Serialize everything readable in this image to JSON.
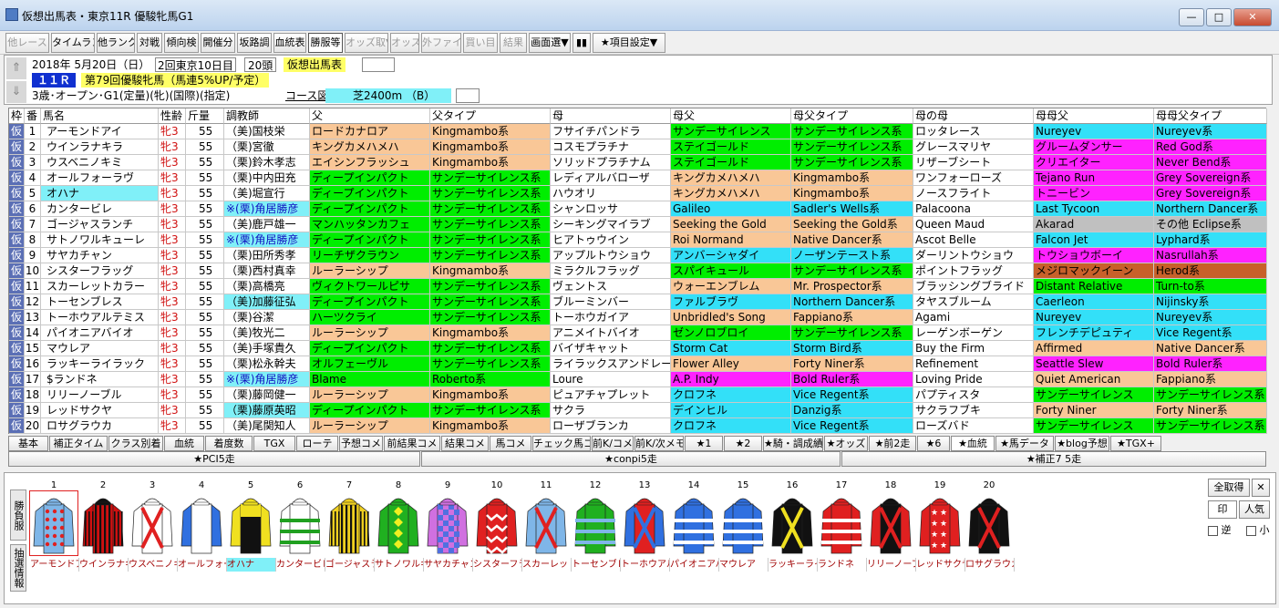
{
  "window": {
    "title": "仮想出馬表・東京11R 優駿牝馬G1",
    "min_label": "—",
    "max_label": "□",
    "close_label": "✕"
  },
  "toolbar": {
    "items": [
      {
        "label": "他レース",
        "disabled": true
      },
      {
        "label": "タイムランク"
      },
      {
        "label": "他ランク"
      },
      {
        "label": "対戦"
      },
      {
        "label": "傾向検"
      },
      {
        "label": "開催分"
      },
      {
        "label": "坂路調"
      },
      {
        "label": "血統表"
      },
      {
        "label": "勝服等",
        "active": true
      },
      {
        "label": "オッズ取▼",
        "disabled": true
      },
      {
        "label": "オッズ",
        "disabled": true
      },
      {
        "label": "外ファイル",
        "disabled": true
      },
      {
        "label": "買い目",
        "disabled": true
      },
      {
        "label": "結果",
        "disabled": true
      },
      {
        "label": "画面選▼"
      },
      {
        "label": "▮▮"
      },
      {
        "label": "★項目設定▼"
      }
    ]
  },
  "race": {
    "date": "2018年 5月20日（日）",
    "kai": "2回東京10日目",
    "heads": "20頭",
    "mode": "仮想出馬表",
    "race_no": "１１Ｒ",
    "name": "第79回優駿牝馬（馬連5%UP/予定）",
    "cond": "3歳･オープン･G1(定量)(牝)(国際)(指定)",
    "course_label": "コース図",
    "course": "芝2400m （B）",
    "up_arrow": "⇑",
    "down_arrow": "⇓"
  },
  "columns": [
    "枠",
    "番",
    "馬名",
    "性齢",
    "斤量",
    "調教師",
    "父",
    "父タイプ",
    "母",
    "母父",
    "母父タイプ",
    "母の母",
    "母母父",
    "母母父タイプ"
  ],
  "entries": [
    {
      "waku": "仮",
      "no": "1",
      "name": "アーモンドアイ",
      "sex": "牝3",
      "wt": "55",
      "trainer": "（美)国枝栄",
      "sire": "ロードカナロア",
      "stype": "Kingmambo系",
      "dam": "フサイチパンドラ",
      "damsire": "サンデーサイレンス",
      "dstype": "サンデーサイレンス系",
      "granddam": "ロッタレース",
      "ggsire": "Nureyev",
      "ggtype": "Nureyev系",
      "c_sire": "#f9c797",
      "c_stype": "#f9c797",
      "c_damsire": "#00ee00",
      "c_dstype": "#00ee00",
      "c_ggsire": "#33e0f8",
      "c_ggtype": "#33e0f8"
    },
    {
      "waku": "仮",
      "no": "2",
      "name": "ウインラナキラ",
      "sex": "牝3",
      "wt": "55",
      "trainer": "（栗)宮徹",
      "sire": "キングカメハメハ",
      "stype": "Kingmambo系",
      "dam": "コスモプラチナ",
      "damsire": "ステイゴールド",
      "dstype": "サンデーサイレンス系",
      "granddam": "グレースマリヤ",
      "ggsire": "グルームダンサー",
      "ggtype": "Red God系",
      "c_sire": "#f9c797",
      "c_stype": "#f9c797",
      "c_damsire": "#00ee00",
      "c_dstype": "#00ee00",
      "c_ggsire": "#ff22ff",
      "c_ggtype": "#ff22ff"
    },
    {
      "waku": "仮",
      "no": "3",
      "name": "ウスベニノキミ",
      "sex": "牝3",
      "wt": "55",
      "trainer": "（栗)鈴木孝志",
      "sire": "エイシンフラッシュ",
      "stype": "Kingmambo系",
      "dam": "ソリッドプラチナム",
      "damsire": "ステイゴールド",
      "dstype": "サンデーサイレンス系",
      "granddam": "リザーブシート",
      "ggsire": "クリエイター",
      "ggtype": "Never Bend系",
      "c_sire": "#f9c797",
      "c_stype": "#f9c797",
      "c_damsire": "#00ee00",
      "c_dstype": "#00ee00",
      "c_ggsire": "#ff22ff",
      "c_ggtype": "#ff22ff"
    },
    {
      "waku": "仮",
      "no": "4",
      "name": "オールフォーラヴ",
      "sex": "牝3",
      "wt": "55",
      "trainer": "（栗)中内田充",
      "sire": "ディープインパクト",
      "stype": "サンデーサイレンス系",
      "dam": "レディアルバローザ",
      "damsire": "キングカメハメハ",
      "dstype": "Kingmambo系",
      "granddam": "ワンフォーローズ",
      "ggsire": "Tejano Run",
      "ggtype": "Grey Sovereign系",
      "c_sire": "#00ee00",
      "c_stype": "#00ee00",
      "c_damsire": "#f9c797",
      "c_dstype": "#f9c797",
      "c_ggsire": "#ff22ff",
      "c_ggtype": "#ff22ff"
    },
    {
      "waku": "仮",
      "no": "5",
      "name": "オハナ",
      "sex": "牝3",
      "wt": "55",
      "trainer": "（美)堀宣行",
      "sire": "ディープインパクト",
      "stype": "サンデーサイレンス系",
      "dam": "ハウオリ",
      "damsire": "キングカメハメハ",
      "dstype": "Kingmambo系",
      "granddam": "ノースフライト",
      "ggsire": "トニービン",
      "ggtype": "Grey Sovereign系",
      "c_sire": "#00ee00",
      "c_stype": "#00ee00",
      "c_damsire": "#f9c797",
      "c_dstype": "#f9c797",
      "c_ggsire": "#ff22ff",
      "c_ggtype": "#ff22ff",
      "hl": true
    },
    {
      "waku": "仮",
      "no": "6",
      "name": "カンタービレ",
      "sex": "牝3",
      "wt": "55",
      "trainer": "※(栗)角居勝彦",
      "sire": "ディープインパクト",
      "stype": "サンデーサイレンス系",
      "dam": "シャンロッサ",
      "damsire": "Galileo",
      "dstype": "Sadler's Wells系",
      "granddam": "Palacoona",
      "ggsire": "Last Tycoon",
      "ggtype": "Northern Dancer系",
      "c_sire": "#00ee00",
      "c_stype": "#00ee00",
      "c_damsire": "#33e0f8",
      "c_dstype": "#33e0f8",
      "c_ggsire": "#33e0f8",
      "c_ggtype": "#33e0f8"
    },
    {
      "waku": "仮",
      "no": "7",
      "name": "ゴージャスランチ",
      "sex": "牝3",
      "wt": "55",
      "trainer": "（美)鹿戸雄一",
      "sire": "マンハッタンカフェ",
      "stype": "サンデーサイレンス系",
      "dam": "シーキングマイラブ",
      "damsire": "Seeking the Gold",
      "dstype": "Seeking the Gold系",
      "granddam": "Queen Maud",
      "ggsire": "Akarad",
      "ggtype": "その他 Eclipse系",
      "c_sire": "#00ee00",
      "c_stype": "#00ee00",
      "c_damsire": "#f9c797",
      "c_dstype": "#f9c797",
      "c_ggsire": "#c0c0c0",
      "c_ggtype": "#c0c0c0"
    },
    {
      "waku": "仮",
      "no": "8",
      "name": "サトノワルキューレ",
      "sex": "牝3",
      "wt": "55",
      "trainer": "※(栗)角居勝彦",
      "sire": "ディープインパクト",
      "stype": "サンデーサイレンス系",
      "dam": "ヒアトゥウイン",
      "damsire": "Roi Normand",
      "dstype": "Native Dancer系",
      "granddam": "Ascot Belle",
      "ggsire": "Falcon Jet",
      "ggtype": "Lyphard系",
      "c_sire": "#00ee00",
      "c_stype": "#00ee00",
      "c_damsire": "#f9c797",
      "c_dstype": "#f9c797",
      "c_ggsire": "#33e0f8",
      "c_ggtype": "#33e0f8"
    },
    {
      "waku": "仮",
      "no": "9",
      "name": "サヤカチャン",
      "sex": "牝3",
      "wt": "55",
      "trainer": "（栗)田所秀孝",
      "sire": "リーチザクラウン",
      "stype": "サンデーサイレンス系",
      "dam": "アップルトウショウ",
      "damsire": "アンバーシャダイ",
      "dstype": "ノーザンテースト系",
      "granddam": "ダーリントウショウ",
      "ggsire": "トウショウボーイ",
      "ggtype": "Nasrullah系",
      "c_sire": "#00ee00",
      "c_stype": "#00ee00",
      "c_damsire": "#33e0f8",
      "c_dstype": "#33e0f8",
      "c_ggsire": "#ff22ff",
      "c_ggtype": "#ff22ff"
    },
    {
      "waku": "仮",
      "no": "10",
      "name": "シスターフラッグ",
      "sex": "牝3",
      "wt": "55",
      "trainer": "（栗)西村真幸",
      "sire": "ルーラーシップ",
      "stype": "Kingmambo系",
      "dam": "ミラクルフラッグ",
      "damsire": "スパイキュール",
      "dstype": "サンデーサイレンス系",
      "granddam": "ポイントフラッグ",
      "ggsire": "メジロマックイーン",
      "ggtype": "Herod系",
      "c_sire": "#f9c797",
      "c_stype": "#f9c797",
      "c_damsire": "#00ee00",
      "c_dstype": "#00ee00",
      "c_ggsire": "#c8602a",
      "c_ggtype": "#c8602a"
    },
    {
      "waku": "仮",
      "no": "11",
      "name": "スカーレットカラー",
      "sex": "牝3",
      "wt": "55",
      "trainer": "（栗)高橋亮",
      "sire": "ヴィクトワールピサ",
      "stype": "サンデーサイレンス系",
      "dam": "ヴェントス",
      "damsire": "ウォーエンブレム",
      "dstype": "Mr. Prospector系",
      "granddam": "ブラッシングブライド",
      "ggsire": "Distant Relative",
      "ggtype": "Turn-to系",
      "c_sire": "#00ee00",
      "c_stype": "#00ee00",
      "c_damsire": "#f9c797",
      "c_dstype": "#f9c797",
      "c_ggsire": "#00ee00",
      "c_ggtype": "#00ee00"
    },
    {
      "waku": "仮",
      "no": "12",
      "name": "トーセンブレス",
      "sex": "牝3",
      "wt": "55",
      "trainer": "（美)加藤征弘",
      "sire": "ディープインパクト",
      "stype": "サンデーサイレンス系",
      "dam": "ブルーミンバー",
      "damsire": "ファルブラヴ",
      "dstype": "Northern Dancer系",
      "granddam": "タヤスブルーム",
      "ggsire": "Caerleon",
      "ggtype": "Nijinsky系",
      "c_sire": "#00ee00",
      "c_stype": "#00ee00",
      "c_damsire": "#33e0f8",
      "c_dstype": "#33e0f8",
      "c_ggsire": "#33e0f8",
      "c_ggtype": "#33e0f8"
    },
    {
      "waku": "仮",
      "no": "13",
      "name": "トーホウアルテミス",
      "sex": "牝3",
      "wt": "55",
      "trainer": "（栗)谷潔",
      "sire": "ハーツクライ",
      "stype": "サンデーサイレンス系",
      "dam": "トーホウガイア",
      "damsire": "Unbridled's Song",
      "dstype": "Fappiano系",
      "granddam": "Agami",
      "ggsire": "Nureyev",
      "ggtype": "Nureyev系",
      "c_sire": "#00ee00",
      "c_stype": "#00ee00",
      "c_damsire": "#f9c797",
      "c_dstype": "#f9c797",
      "c_ggsire": "#33e0f8",
      "c_ggtype": "#33e0f8"
    },
    {
      "waku": "仮",
      "no": "14",
      "name": "パイオニアバイオ",
      "sex": "牝3",
      "wt": "55",
      "trainer": "（美)牧光二",
      "sire": "ルーラーシップ",
      "stype": "Kingmambo系",
      "dam": "アニメイトバイオ",
      "damsire": "ゼンノロブロイ",
      "dstype": "サンデーサイレンス系",
      "granddam": "レーゲンボーゲン",
      "ggsire": "フレンチデピュティ",
      "ggtype": "Vice Regent系",
      "c_sire": "#f9c797",
      "c_stype": "#f9c797",
      "c_damsire": "#00ee00",
      "c_dstype": "#00ee00",
      "c_ggsire": "#33e0f8",
      "c_ggtype": "#33e0f8"
    },
    {
      "waku": "仮",
      "no": "15",
      "name": "マウレア",
      "sex": "牝3",
      "wt": "55",
      "trainer": "（美)手塚貴久",
      "sire": "ディープインパクト",
      "stype": "サンデーサイレンス系",
      "dam": "バイザキャット",
      "damsire": "Storm Cat",
      "dstype": "Storm Bird系",
      "granddam": "Buy the Firm",
      "ggsire": "Affirmed",
      "ggtype": "Native Dancer系",
      "c_sire": "#00ee00",
      "c_stype": "#00ee00",
      "c_damsire": "#33e0f8",
      "c_dstype": "#33e0f8",
      "c_ggsire": "#f9c797",
      "c_ggtype": "#f9c797"
    },
    {
      "waku": "仮",
      "no": "16",
      "name": "ラッキーライラック",
      "sex": "牝3",
      "wt": "55",
      "trainer": "（栗)松永幹夫",
      "sire": "オルフェーヴル",
      "stype": "サンデーサイレンス系",
      "dam": "ライラックスアンドレース",
      "damsire": "Flower Alley",
      "dstype": "Forty Niner系",
      "granddam": "Refinement",
      "ggsire": "Seattle Slew",
      "ggtype": "Bold Ruler系",
      "c_sire": "#00ee00",
      "c_stype": "#00ee00",
      "c_damsire": "#f9c797",
      "c_dstype": "#f9c797",
      "c_ggsire": "#ff22ff",
      "c_ggtype": "#ff22ff"
    },
    {
      "waku": "仮",
      "no": "17",
      "name": "$ランドネ",
      "sex": "牝3",
      "wt": "55",
      "trainer": "※(栗)角居勝彦",
      "sire": "Blame",
      "stype": "Roberto系",
      "dam": "Loure",
      "damsire": "A.P. Indy",
      "dstype": "Bold Ruler系",
      "granddam": "Loving Pride",
      "ggsire": "Quiet American",
      "ggtype": "Fappiano系",
      "c_sire": "#00ee00",
      "c_stype": "#00ee00",
      "c_damsire": "#ff22ff",
      "c_dstype": "#ff22ff",
      "c_ggsire": "#f9c797",
      "c_ggtype": "#f9c797"
    },
    {
      "waku": "仮",
      "no": "18",
      "name": "リリーノーブル",
      "sex": "牝3",
      "wt": "55",
      "trainer": "（栗)藤岡健一",
      "sire": "ルーラーシップ",
      "stype": "Kingmambo系",
      "dam": "ピュアチャプレット",
      "damsire": "クロフネ",
      "dstype": "Vice Regent系",
      "granddam": "パプティスタ",
      "ggsire": "サンデーサイレンス",
      "ggtype": "サンデーサイレンス系",
      "c_sire": "#f9c797",
      "c_stype": "#f9c797",
      "c_damsire": "#33e0f8",
      "c_dstype": "#33e0f8",
      "c_ggsire": "#00ee00",
      "c_ggtype": "#00ee00"
    },
    {
      "waku": "仮",
      "no": "19",
      "name": "レッドサクヤ",
      "sex": "牝3",
      "wt": "55",
      "trainer": "（栗)藤原英昭",
      "sire": "ディープインパクト",
      "stype": "サンデーサイレンス系",
      "dam": "サクラ",
      "damsire": "デインヒル",
      "dstype": "Danzig系",
      "granddam": "サクラフブキ",
      "ggsire": "Forty Niner",
      "ggtype": "Forty Niner系",
      "c_sire": "#00ee00",
      "c_stype": "#00ee00",
      "c_damsire": "#33e0f8",
      "c_dstype": "#33e0f8",
      "c_ggsire": "#f9c797",
      "c_ggtype": "#f9c797"
    },
    {
      "waku": "仮",
      "no": "20",
      "name": "ロサグラウカ",
      "sex": "牝3",
      "wt": "55",
      "trainer": "（美)尾関知人",
      "sire": "ルーラーシップ",
      "stype": "Kingmambo系",
      "dam": "ローザブランカ",
      "damsire": "クロフネ",
      "dstype": "Vice Regent系",
      "granddam": "ローズバド",
      "ggsire": "サンデーサイレンス",
      "ggtype": "サンデーサイレンス系",
      "c_sire": "#f9c797",
      "c_stype": "#f9c797",
      "c_damsire": "#33e0f8",
      "c_dstype": "#33e0f8",
      "c_ggsire": "#00ee00",
      "c_ggtype": "#00ee00"
    }
  ],
  "tabs_row1": [
    "基本",
    "補正タイム",
    "クラス別着",
    "血統",
    "着度数",
    "TGX",
    "ローテ",
    "予想コメ",
    "前結果コメ",
    "結果コメ",
    "馬コメ",
    "チェック馬コメ",
    "前K/コメ",
    "前K/次メモ",
    "★1",
    "★2",
    "★騎・調成績",
    "★オッズ",
    "★前2走",
    "★6",
    "★血統",
    "★馬データ",
    "★blog予想",
    "★TGX+"
  ],
  "tabs_row2": [
    "★PCI5走",
    "★conpi5走",
    "★補正7 5走"
  ],
  "bottom": {
    "label_top": "勝負服",
    "label_bottom": "抽選情報",
    "buttons": {
      "all": "全取得",
      "close": "✕",
      "print": "印",
      "popular": "人気",
      "rev": "逆",
      "small": "小"
    },
    "silks": [
      {
        "no": "1",
        "body": "#7fb6e8",
        "sleeve": "#7fb6e8",
        "pat": "dots",
        "pc": "#e02020",
        "cap": "#7fb6e8",
        "name": "アーモンドアイ"
      },
      {
        "no": "2",
        "body": "#d01010",
        "sleeve": "#d01010",
        "pat": "vstripes",
        "pc": "#111111",
        "cap": "#111111",
        "name": "ウインラナキラ"
      },
      {
        "no": "3",
        "body": "#ffffff",
        "sleeve": "#ffffff",
        "pat": "cross",
        "pc": "#e02020",
        "cap": "#ffffff",
        "name": "ウスベニノキミ"
      },
      {
        "no": "4",
        "body": "#ffffff",
        "sleeve": "#3070e0",
        "pat": "none",
        "pc": "#3070e0",
        "cap": "#ffffff",
        "name": "オールフォーラヴ"
      },
      {
        "no": "5",
        "body": "#111111",
        "sleeve": "#f0e020",
        "pat": "yoke",
        "pc": "#f0e020",
        "cap": "#f0e020",
        "name": "オハナ"
      },
      {
        "no": "6",
        "body": "#ffffff",
        "sleeve": "#ffffff",
        "pat": "hbands",
        "pc": "#20a020",
        "cap": "#ffffff",
        "name": "カンタービレ"
      },
      {
        "no": "7",
        "body": "#f0d020",
        "sleeve": "#f0d020",
        "pat": "vstripes",
        "pc": "#111111",
        "cap": "#f0d020",
        "name": "ゴージャスランチ"
      },
      {
        "no": "8",
        "body": "#20b020",
        "sleeve": "#20b020",
        "pat": "diamonds",
        "pc": "#f0f020",
        "cap": "#20b020",
        "name": "サトノワルキューレ"
      },
      {
        "no": "9",
        "body": "#d070e0",
        "sleeve": "#d070e0",
        "pat": "checks",
        "pc": "#5070e0",
        "cap": "#d070e0",
        "name": "サヤカチャン"
      },
      {
        "no": "10",
        "body": "#e02020",
        "sleeve": "#e02020",
        "pat": "zigzag",
        "pc": "#ffffff",
        "cap": "#e02020",
        "name": "シスターフラッグ"
      },
      {
        "no": "11",
        "body": "#7fb6e8",
        "sleeve": "#7fb6e8",
        "pat": "cross",
        "pc": "#e02020",
        "cap": "#7fb6e8",
        "name": "スカーレットカラー"
      },
      {
        "no": "12",
        "body": "#20b020",
        "sleeve": "#20b020",
        "pat": "hbands",
        "pc": "#7fb6e8",
        "cap": "#20b020",
        "name": "トーセンブレス"
      },
      {
        "no": "13",
        "body": "#e02020",
        "sleeve": "#3070e0",
        "pat": "cross",
        "pc": "#3070e0",
        "cap": "#e02020",
        "name": "トーホウアルテミス"
      },
      {
        "no": "14",
        "body": "#3070e0",
        "sleeve": "#3070e0",
        "pat": "hbands",
        "pc": "#ffffff",
        "cap": "#3070e0",
        "name": "パイオニアバイオ"
      },
      {
        "no": "15",
        "body": "#3070e0",
        "sleeve": "#3070e0",
        "pat": "hbands",
        "pc": "#ffffff",
        "cap": "#3070e0",
        "name": "マウレア"
      },
      {
        "no": "16",
        "body": "#111111",
        "sleeve": "#111111",
        "pat": "cross",
        "pc": "#f0e020",
        "cap": "#111111",
        "name": "ラッキーライラック"
      },
      {
        "no": "17",
        "body": "#e02020",
        "sleeve": "#e02020",
        "pat": "hbands",
        "pc": "#ffffff",
        "cap": "#e02020",
        "name": "ランドネ"
      },
      {
        "no": "18",
        "body": "#111111",
        "sleeve": "#e02020",
        "pat": "cross",
        "pc": "#e02020",
        "cap": "#111111",
        "name": "リリーノーブル"
      },
      {
        "no": "19",
        "body": "#e02020",
        "sleeve": "#e02020",
        "pat": "stars",
        "pc": "#ffffff",
        "cap": "#e02020",
        "name": "レッドサクヤ"
      },
      {
        "no": "20",
        "body": "#111111",
        "sleeve": "#111111",
        "pat": "cross",
        "pc": "#e02020",
        "cap": "#111111",
        "name": "ロサグラウカ"
      }
    ]
  }
}
